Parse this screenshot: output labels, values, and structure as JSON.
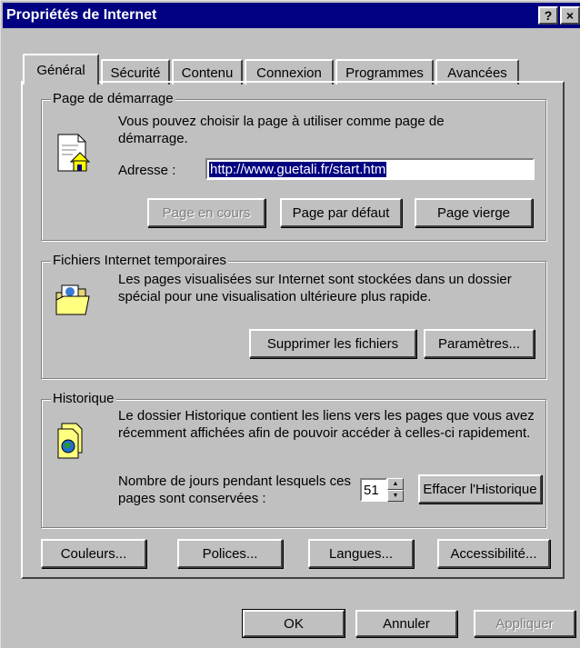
{
  "window": {
    "title": "Propriétés de Internet",
    "help_button": "?",
    "close_button": "×"
  },
  "tabs": [
    {
      "label": "Général",
      "active": true
    },
    {
      "label": "Sécurité"
    },
    {
      "label": "Contenu"
    },
    {
      "label": "Connexion"
    },
    {
      "label": "Programmes"
    },
    {
      "label": "Avancées"
    }
  ],
  "home_page": {
    "legend": "Page de démarrage",
    "description": "Vous pouvez choisir la page à utiliser comme page de démarrage.",
    "address_label": "Adresse :",
    "address_value": "http://www.guetali.fr/start.htm",
    "btn_current": "Page en cours",
    "btn_default": "Page par défaut",
    "btn_blank": "Page vierge"
  },
  "temp_files": {
    "legend": "Fichiers Internet temporaires",
    "description": "Les pages visualisées sur Internet sont stockées dans un dossier spécial pour une visualisation ultérieure plus rapide.",
    "btn_delete": "Supprimer les fichiers",
    "btn_settings": "Paramètres..."
  },
  "history": {
    "legend": "Historique",
    "description": "Le dossier Historique contient les liens vers les pages que vous avez récemment affichées afin de pouvoir accéder à celles-ci  rapidement.",
    "days_label": "Nombre de jours pendant lesquels ces pages sont conservées :",
    "days_value": "51",
    "btn_clear": "Effacer l'Historique"
  },
  "bottom_buttons": {
    "colors": "Couleurs...",
    "fonts": "Polices...",
    "languages": "Langues...",
    "accessibility": "Accessibilité..."
  },
  "dialog_buttons": {
    "ok": "OK",
    "cancel": "Annuler",
    "apply": "Appliquer"
  }
}
